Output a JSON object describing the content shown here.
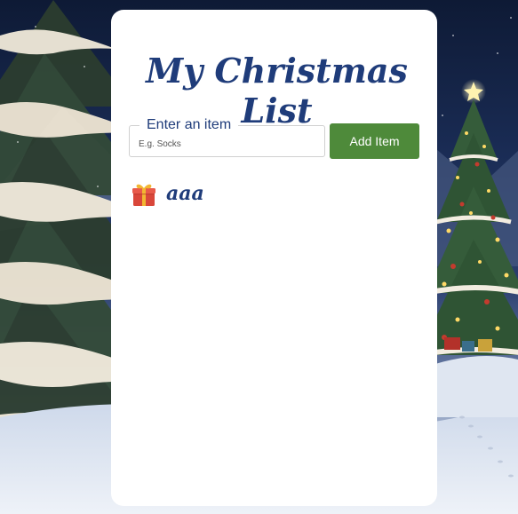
{
  "app": {
    "title": "My Christmas List"
  },
  "form": {
    "legend": "Enter an item",
    "input_placeholder": "E.g. Socks",
    "input_value": "",
    "add_button_label": "Add Item"
  },
  "list": {
    "items": [
      {
        "icon": "gift-icon",
        "label": "aaa"
      }
    ]
  },
  "colors": {
    "title": "#1f3c7a",
    "button": "#4e8a3a",
    "card": "#ffffff"
  }
}
